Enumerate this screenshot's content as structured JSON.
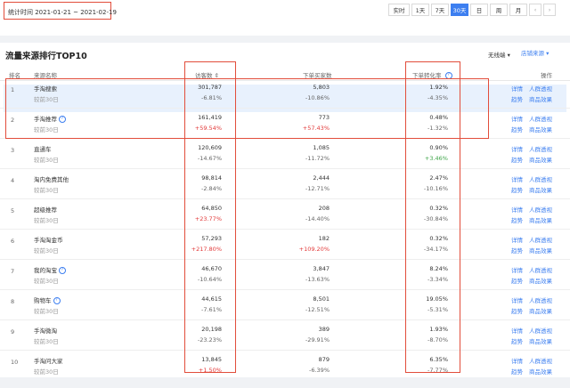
{
  "date_range": {
    "label": "统计时间 2021-01-21 ~ 2021-02-19"
  },
  "range_buttons": [
    "实时",
    "1天",
    "7天",
    "30天",
    "日",
    "周",
    "月"
  ],
  "range_active": "30天",
  "nav_prev": "‹",
  "nav_next": "›",
  "card": {
    "title": "流量来源排行TOP10",
    "no_line_label": "无线端",
    "no_line_caret": "▾",
    "source_button": "店铺来源",
    "source_caret": "▾"
  },
  "columns": {
    "rank": "排名",
    "source": "来源名称",
    "visitors": "访客数",
    "visitors_sort": "⇕",
    "buyers": "下单买家数",
    "conversion": "下单转化率",
    "help": "?",
    "action": "操作"
  },
  "rows": [
    {
      "rank": "1",
      "name": "手淘搜索",
      "help": "",
      "sub": "较前30日",
      "visitors": "301,787",
      "v_change": "-6.81%",
      "buyers": "5,803",
      "b_change": "-10.86%",
      "rate": "1.92%",
      "r_change": "-4.35%",
      "ops": [
        "详情",
        "人群透视",
        "趋势",
        "商品效果"
      ]
    },
    {
      "rank": "2",
      "name": "手淘推荐",
      "help": "?",
      "sub": "较前30日",
      "visitors": "161,419",
      "v_change": "+59.54%",
      "buyers": "773",
      "b_change": "+57.43%",
      "rate": "0.48%",
      "r_change": "-1.32%",
      "ops": [
        "详情",
        "人群透视",
        "趋势",
        "商品效果"
      ]
    },
    {
      "rank": "3",
      "name": "直通车",
      "help": "",
      "sub": "较前30日",
      "visitors": "120,609",
      "v_change": "-14.67%",
      "buyers": "1,085",
      "b_change": "-11.72%",
      "rate": "0.90%",
      "r_change": "+3.46%",
      "ops": [
        "详情",
        "人群透视",
        "趋势",
        "商品效果"
      ]
    },
    {
      "rank": "4",
      "name": "淘内免费其他",
      "help": "",
      "sub": "较前30日",
      "visitors": "98,814",
      "v_change": "-2.84%",
      "buyers": "2,444",
      "b_change": "-12.71%",
      "rate": "2.47%",
      "r_change": "-10.16%",
      "ops": [
        "详情",
        "人群透视",
        "趋势",
        "商品效果"
      ]
    },
    {
      "rank": "5",
      "name": "超级推荐",
      "help": "",
      "sub": "较前30日",
      "visitors": "64,850",
      "v_change": "+23.77%",
      "buyers": "208",
      "b_change": "-14.40%",
      "rate": "0.32%",
      "r_change": "-30.84%",
      "ops": [
        "详情",
        "人群透视",
        "趋势",
        "商品效果"
      ]
    },
    {
      "rank": "6",
      "name": "手淘淘金币",
      "help": "",
      "sub": "较前30日",
      "visitors": "57,293",
      "v_change": "+217.80%",
      "buyers": "182",
      "b_change": "+109.20%",
      "rate": "0.32%",
      "r_change": "-34.17%",
      "ops": [
        "详情",
        "人群透视",
        "趋势",
        "商品效果"
      ]
    },
    {
      "rank": "7",
      "name": "我的淘宝",
      "help": "?",
      "sub": "较前30日",
      "visitors": "46,670",
      "v_change": "-10.64%",
      "buyers": "3,847",
      "b_change": "-13.63%",
      "rate": "8.24%",
      "r_change": "-3.34%",
      "ops": [
        "详情",
        "人群透视",
        "趋势",
        "商品效果"
      ]
    },
    {
      "rank": "8",
      "name": "购物车",
      "help": "?",
      "sub": "较前30日",
      "visitors": "44,615",
      "v_change": "-7.61%",
      "buyers": "8,501",
      "b_change": "-12.51%",
      "rate": "19.05%",
      "r_change": "-5.31%",
      "ops": [
        "详情",
        "人群透视",
        "趋势",
        "商品效果"
      ]
    },
    {
      "rank": "9",
      "name": "手淘微淘",
      "help": "",
      "sub": "较前30日",
      "visitors": "20,198",
      "v_change": "-23.23%",
      "buyers": "389",
      "b_change": "-29.91%",
      "rate": "1.93%",
      "r_change": "-8.70%",
      "ops": [
        "详情",
        "人群透视",
        "趋势",
        "商品效果"
      ]
    },
    {
      "rank": "10",
      "name": "手淘问大家",
      "help": "",
      "sub": "较前30日",
      "visitors": "13,845",
      "v_change": "+1.50%",
      "buyers": "879",
      "b_change": "-6.39%",
      "rate": "6.35%",
      "r_change": "-7.77%",
      "ops": [
        "详情",
        "人群透视",
        "趋势",
        "商品效果"
      ]
    }
  ],
  "colors": {
    "accent": "#3d7ff0",
    "highlight_row": "#e8f1fd",
    "annotation": "#e24d3b",
    "increase": "#e23a3a",
    "decrease_rate": "#3fa54a"
  }
}
